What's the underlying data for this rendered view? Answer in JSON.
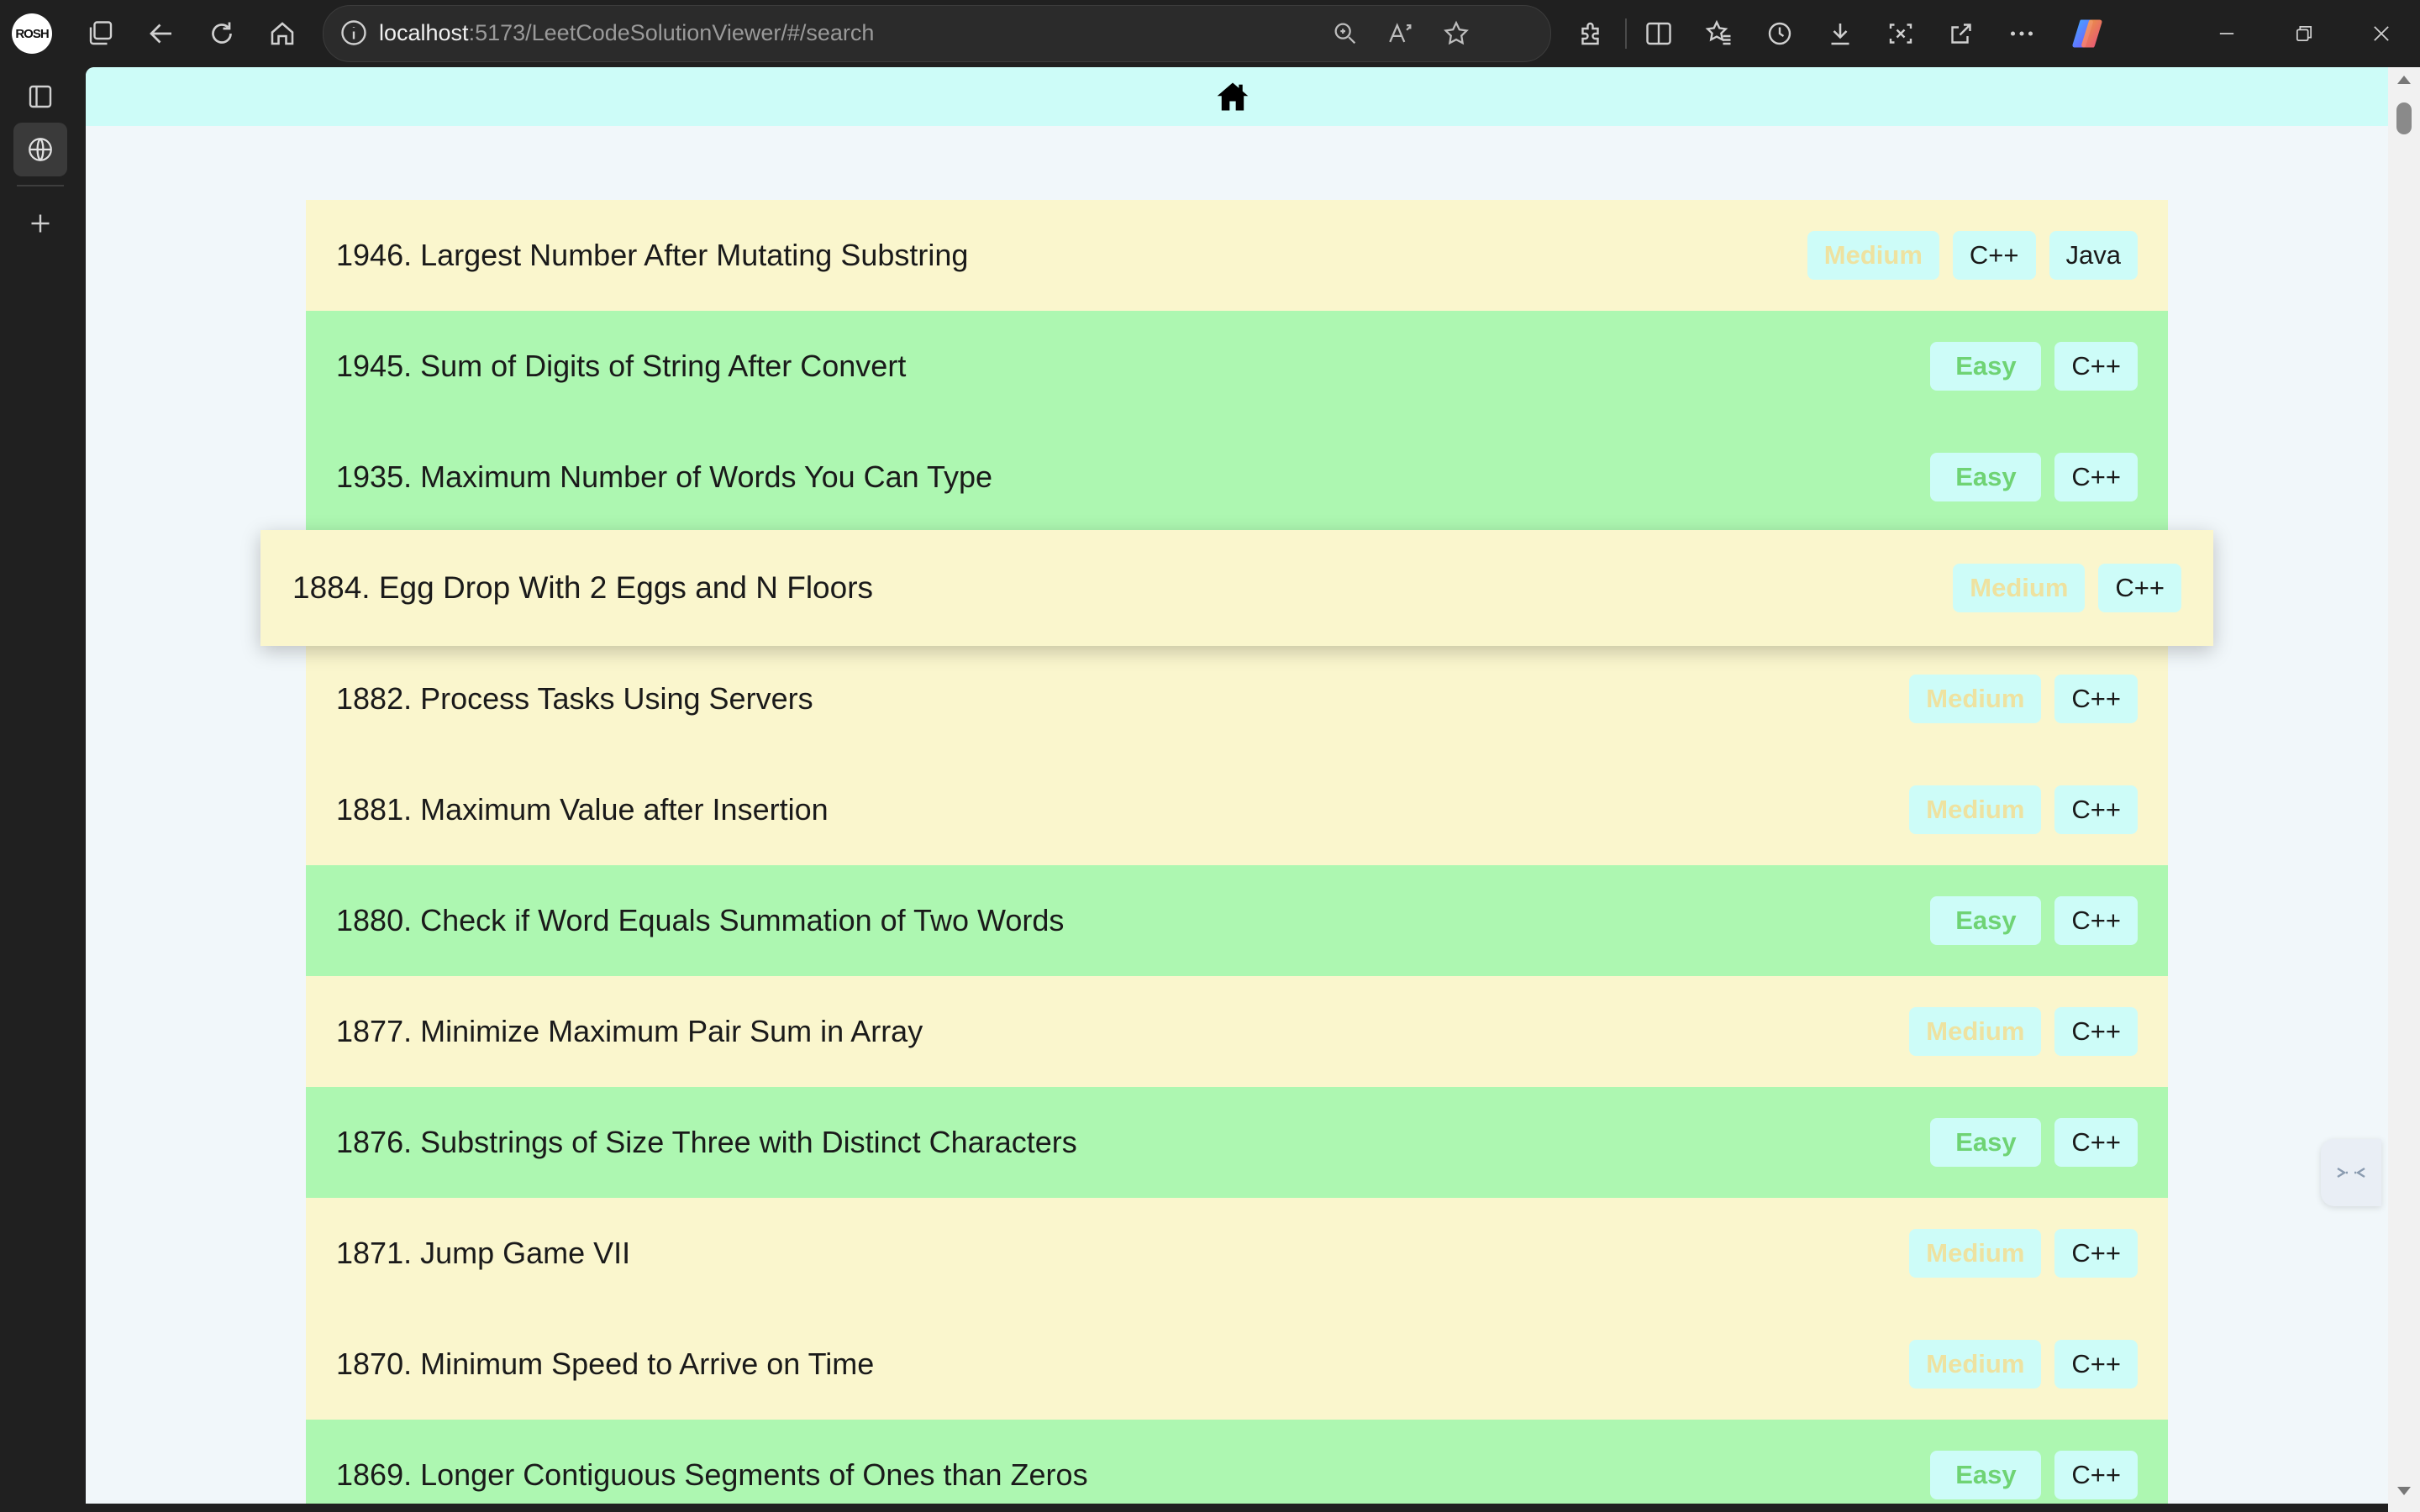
{
  "browser": {
    "profile_label": "ROSH",
    "address": {
      "host": "localhost",
      "rest": ":5173/LeetCodeSolutionViewer/#/search"
    },
    "icons": {
      "tab_actions": "tab-actions-icon",
      "back": "back-icon",
      "refresh": "refresh-icon",
      "home": "home-icon",
      "site_info": "info-icon",
      "zoom": "zoom-icon",
      "read_aloud": "read-aloud-icon",
      "favorite": "star-icon",
      "extensions": "puzzle-icon",
      "split_screen": "split-screen-icon",
      "favorites": "favorites-icon",
      "history": "history-icon",
      "downloads": "download-icon",
      "screenshot": "screenshot-icon",
      "share": "share-icon",
      "more": "more-icon",
      "copilot": "copilot-icon",
      "minimize": "minimize-icon",
      "restore": "restore-icon",
      "close": "close-icon"
    }
  },
  "sidebar": {
    "icons": [
      "tab-panel-icon",
      "globe-icon",
      "plus-icon"
    ]
  },
  "page": {
    "home_icon": "home-icon",
    "colors": {
      "header": "#cdfcf8",
      "medium_row": "#faf6cd",
      "easy_row": "#adf7b1",
      "tag_bg": "#cdfcf8",
      "medium_text": "#eee2a0",
      "easy_text": "#6fd374"
    },
    "problems": [
      {
        "title": "1946. Largest Number After Mutating Substring",
        "difficulty": "Medium",
        "langs": [
          "C++",
          "Java"
        ]
      },
      {
        "title": "1945. Sum of Digits of String After Convert",
        "difficulty": "Easy",
        "langs": [
          "C++"
        ]
      },
      {
        "title": "1935. Maximum Number of Words You Can Type",
        "difficulty": "Easy",
        "langs": [
          "C++"
        ]
      },
      {
        "title": "1884. Egg Drop With 2 Eggs and N Floors",
        "difficulty": "Medium",
        "langs": [
          "C++"
        ]
      },
      {
        "title": "1882. Process Tasks Using Servers",
        "difficulty": "Medium",
        "langs": [
          "C++"
        ]
      },
      {
        "title": "1881. Maximum Value after Insertion",
        "difficulty": "Medium",
        "langs": [
          "C++"
        ]
      },
      {
        "title": "1880. Check if Word Equals Summation of Two Words",
        "difficulty": "Easy",
        "langs": [
          "C++"
        ]
      },
      {
        "title": "1877. Minimize Maximum Pair Sum in Array",
        "difficulty": "Medium",
        "langs": [
          "C++"
        ]
      },
      {
        "title": "1876. Substrings of Size Three with Distinct Characters",
        "difficulty": "Easy",
        "langs": [
          "C++"
        ]
      },
      {
        "title": "1871. Jump Game VII",
        "difficulty": "Medium",
        "langs": [
          "C++"
        ]
      },
      {
        "title": "1870. Minimum Speed to Arrive on Time",
        "difficulty": "Medium",
        "langs": [
          "C++"
        ]
      },
      {
        "title": "1869. Longer Contiguous Segments of Ones than Zeros",
        "difficulty": "Easy",
        "langs": [
          "C++"
        ]
      }
    ]
  }
}
